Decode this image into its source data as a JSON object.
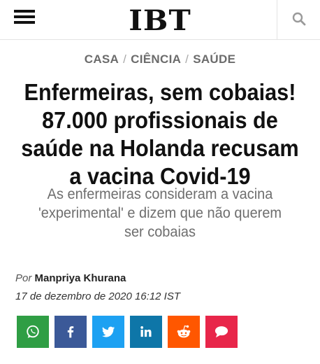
{
  "header": {
    "logo": "IBT",
    "menu_icon": "hamburger-menu-icon",
    "search_icon": "search-icon"
  },
  "breadcrumb": [
    "CASA",
    "CIÊNCIA",
    "SAÚDE"
  ],
  "article": {
    "headline_lines": [
      "Enfermeiras, sem cobaias!",
      "87.000 profissionais de",
      "saúde na Holanda recusam",
      "a vacina Covid-19"
    ],
    "subhead_lines": [
      "As enfermeiras consideram a vacina",
      "'experimental' e dizem que não querem",
      "ser cobaias"
    ],
    "by_prefix": "Por",
    "author": "Manpriya Khurana",
    "date": "17 de dezembro de 2020 16:12 IST"
  },
  "share_buttons": [
    {
      "network": "whatsapp",
      "icon": "whatsapp-icon",
      "color": "#2f9e44"
    },
    {
      "network": "facebook",
      "icon": "facebook-icon",
      "color": "#3b5998"
    },
    {
      "network": "twitter",
      "icon": "twitter-icon",
      "color": "#1da1f2"
    },
    {
      "network": "linkedin",
      "icon": "linkedin-icon",
      "color": "#0e76a8"
    },
    {
      "network": "reddit",
      "icon": "reddit-icon",
      "color": "#ff5700"
    },
    {
      "network": "comment",
      "icon": "speech-bubble-icon",
      "color": "#e8264a"
    }
  ],
  "colors": {
    "breadcrumb": "#6b6b6b",
    "subhead": "#6e6e6e",
    "headline": "#111111"
  }
}
